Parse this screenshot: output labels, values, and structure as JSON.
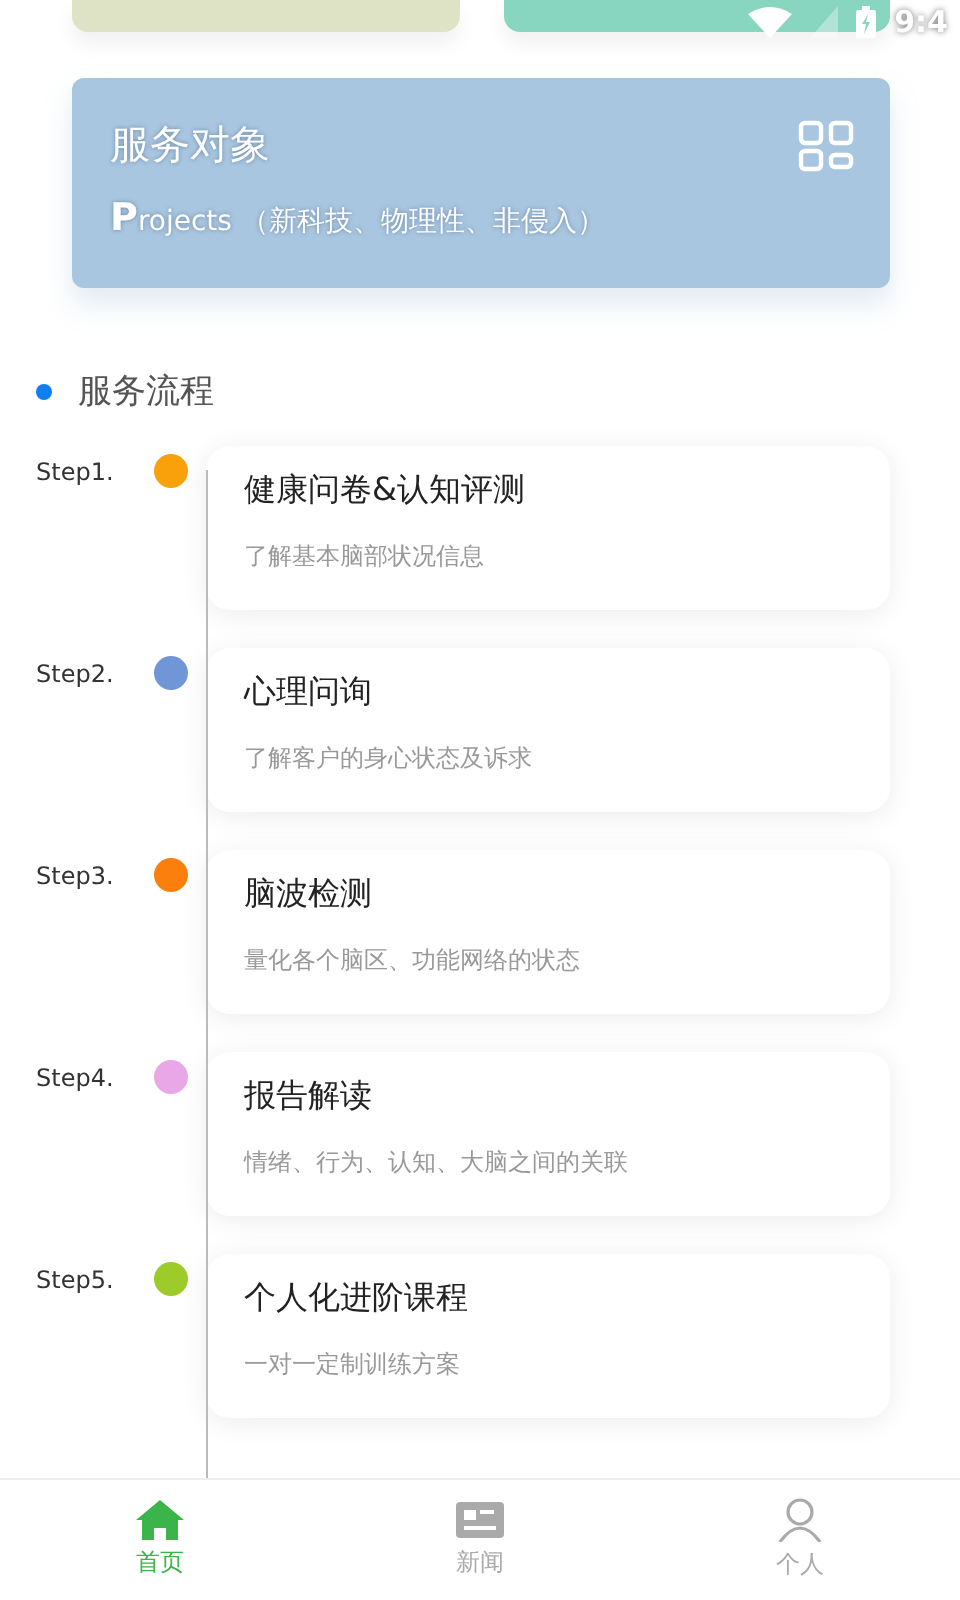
{
  "status_bar": {
    "time": "9:4"
  },
  "service_target": {
    "title": "服务对象",
    "subtitle": "**P**rojects （新科技、物理性、非侵入）"
  },
  "section": {
    "title": "服务流程"
  },
  "steps": [
    {
      "label": "Step1.",
      "title": "健康问卷&认知评测",
      "desc": "了解基本脑部状况信息",
      "color": "#f9a10a"
    },
    {
      "label": "Step2.",
      "title": "心理问询",
      "desc": "了解客户的身心状态及诉求",
      "color": "#7196d8"
    },
    {
      "label": "Step3.",
      "title": "脑波检测",
      "desc": "量化各个脑区、功能网络的状态",
      "color": "#fb7f0c"
    },
    {
      "label": "Step4.",
      "title": "报告解读",
      "desc": "情绪、行为、认知、大脑之间的关联",
      "color": "#e9a7e8"
    },
    {
      "label": "Step5.",
      "title": "个人化进阶课程",
      "desc": "一对一定制训练方案",
      "color": "#9ccb2a"
    }
  ],
  "bottom_nav": [
    {
      "label": "首页",
      "kind": "home",
      "selected": true
    },
    {
      "label": "新闻",
      "kind": "news",
      "selected": false
    },
    {
      "label": "个人",
      "kind": "person",
      "selected": false
    }
  ]
}
